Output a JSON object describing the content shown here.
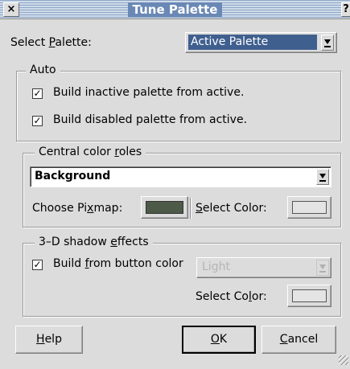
{
  "window": {
    "title": "Tune Palette",
    "close_glyph": "×",
    "help_glyph": "?"
  },
  "select_palette": {
    "label_pre": "Select ",
    "label_u": "P",
    "label_post": "alette:",
    "value": "Active Palette"
  },
  "auto": {
    "legend": "Auto",
    "items": [
      {
        "label": "Build inactive palette from active.",
        "checked": "✓"
      },
      {
        "label": "Build disabled palette from active.",
        "checked": "✓"
      }
    ]
  },
  "central": {
    "legend_pre": "Central color ",
    "legend_u": "r",
    "legend_post": "oles",
    "role": "Background",
    "pixmap_pre": "Choose Pi",
    "pixmap_u": "x",
    "pixmap_post": "map:",
    "pixmap_color": "#4e5a48",
    "color_u": "S",
    "color_post": "elect Color:",
    "swatch_color": "#e4e4e4"
  },
  "shadow": {
    "legend_pre": "3–D shadow ",
    "legend_u": "e",
    "legend_post": "ffects",
    "build_pre": "Build ",
    "build_u": "f",
    "build_post": "rom button color",
    "checked": "✓",
    "mode": "Light",
    "color_pre": "Select Co",
    "color_u": "l",
    "color_post": "or:"
  },
  "buttons": {
    "help_u": "H",
    "help_post": "elp",
    "ok_u": "O",
    "ok_post": "K",
    "cancel_u": "C",
    "cancel_post": "ancel"
  }
}
